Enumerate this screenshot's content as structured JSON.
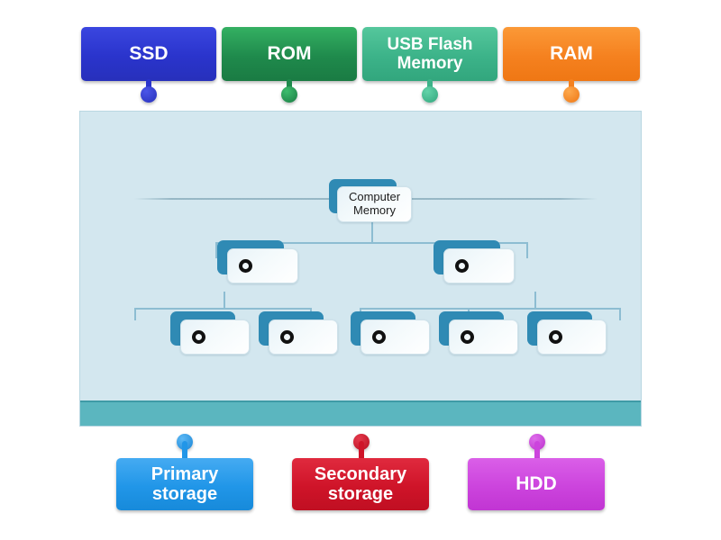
{
  "activity": {
    "type": "drag-and-drop-labelled-diagram",
    "title": "Computer Memory"
  },
  "top_labels": [
    {
      "id": "ssd",
      "text": "SSD",
      "color": "#2a34cc",
      "color_light": "#3a46e0"
    },
    {
      "id": "rom",
      "text": "ROM",
      "color": "#1f8a4c",
      "color_light": "#34b062"
    },
    {
      "id": "usb",
      "text": "USB Flash Memory",
      "color": "#3cb389",
      "color_light": "#55c79c"
    },
    {
      "id": "ram",
      "text": "RAM",
      "color": "#f5811f",
      "color_light": "#fb9937"
    }
  ],
  "bottom_labels": [
    {
      "id": "primary",
      "text": "Primary storage",
      "color": "#2196e8",
      "color_light": "#45abf2"
    },
    {
      "id": "secondary",
      "text": "Secondary storage",
      "color": "#cf1429",
      "color_light": "#e02a3e"
    },
    {
      "id": "hdd",
      "text": "HDD",
      "color": "#cc44dd",
      "color_light": "#da5fe8"
    }
  ],
  "diagram": {
    "root": {
      "id": "node-root",
      "text": "Computer Memory",
      "filled": true
    },
    "level2": [
      {
        "id": "node-l2-1",
        "text": "",
        "filled": false
      },
      {
        "id": "node-l2-2",
        "text": "",
        "filled": false
      }
    ],
    "level3": [
      {
        "id": "node-l3-1",
        "text": "",
        "filled": false
      },
      {
        "id": "node-l3-2",
        "text": "",
        "filled": false
      },
      {
        "id": "node-l3-3",
        "text": "",
        "filled": false
      },
      {
        "id": "node-l3-4",
        "text": "",
        "filled": false
      },
      {
        "id": "node-l3-5",
        "text": "",
        "filled": false
      }
    ]
  },
  "canvas": {
    "background": "#d3e7ef",
    "footer_color": "#5bb6bf",
    "node_back_color": "#2f8ab4",
    "connector_color": "#8dbdd2"
  }
}
